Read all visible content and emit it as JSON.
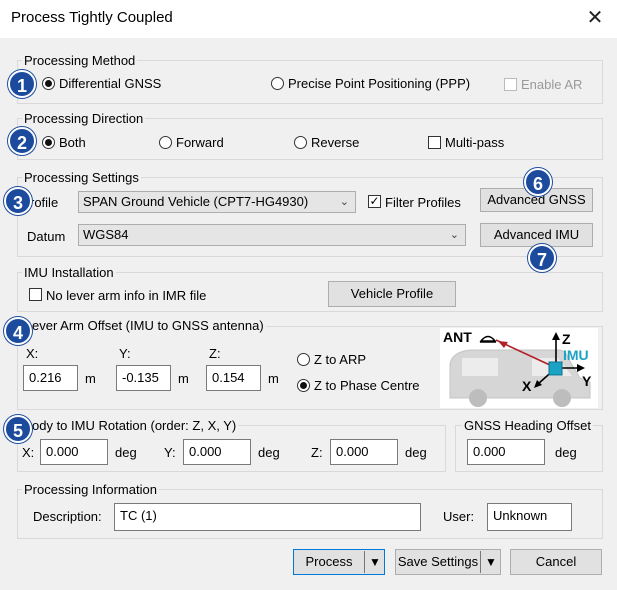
{
  "window": {
    "title": "Process Tightly Coupled",
    "close_glyph": "✕"
  },
  "badges": [
    "1",
    "2",
    "3",
    "4",
    "5",
    "6",
    "7"
  ],
  "method": {
    "title": "Processing Method",
    "options": [
      "Differential GNSS",
      "Precise Point Positioning (PPP)"
    ],
    "selected": 0,
    "enable_ar": "Enable AR"
  },
  "direction": {
    "title": "Processing Direction",
    "options": [
      "Both",
      "Forward",
      "Reverse"
    ],
    "selected": 0,
    "multipass": "Multi-pass"
  },
  "settings": {
    "title": "Processing Settings",
    "profile_label": "rofile",
    "profile_value": "SPAN Ground Vehicle (CPT7-HG4930)",
    "filter_profiles": "Filter Profiles",
    "filter_checked": true,
    "datum_label": "Datum",
    "datum_value": "WGS84",
    "advanced_gnss": "Advanced GNSS",
    "advanced_imu": "Advanced IMU"
  },
  "imu_install": {
    "title": "IMU Installation",
    "no_lever": "No lever arm info in IMR file",
    "vehicle_profile": "Vehicle Profile"
  },
  "lever_arm": {
    "title": "ever Arm Offset (IMU to GNSS antenna)",
    "x_label": "X:",
    "x_value": "0.216",
    "y_label": "Y:",
    "y_value": "-0.135",
    "z_label": "Z:",
    "z_value": "0.154",
    "unit": "m",
    "z_options": [
      "Z to ARP",
      "Z to Phase Centre"
    ],
    "z_selected": 1,
    "diagram": {
      "ant": "ANT",
      "imu": "IMU",
      "x": "X",
      "y": "Y",
      "z": "Z"
    }
  },
  "rotation": {
    "title": "ody to IMU Rotation (order: Z, X, Y)",
    "x_label": "X:",
    "x_value": "0.000",
    "y_label": "Y:",
    "y_value": "0.000",
    "z_label": "Z:",
    "z_value": "0.000",
    "unit": "deg"
  },
  "heading": {
    "title": "GNSS Heading Offset",
    "value": "0.000",
    "unit": "deg"
  },
  "info": {
    "title": "Processing Information",
    "description_label": "Description:",
    "description_value": "TC (1)",
    "user_label": "User:",
    "user_value": "Unknown"
  },
  "footer": {
    "process": "Process",
    "save_settings": "Save Settings",
    "cancel": "Cancel"
  },
  "colors": {
    "badge": "#1c4b9e",
    "imu_marker": "#1ba3c6",
    "arrow": "#b0202a"
  }
}
